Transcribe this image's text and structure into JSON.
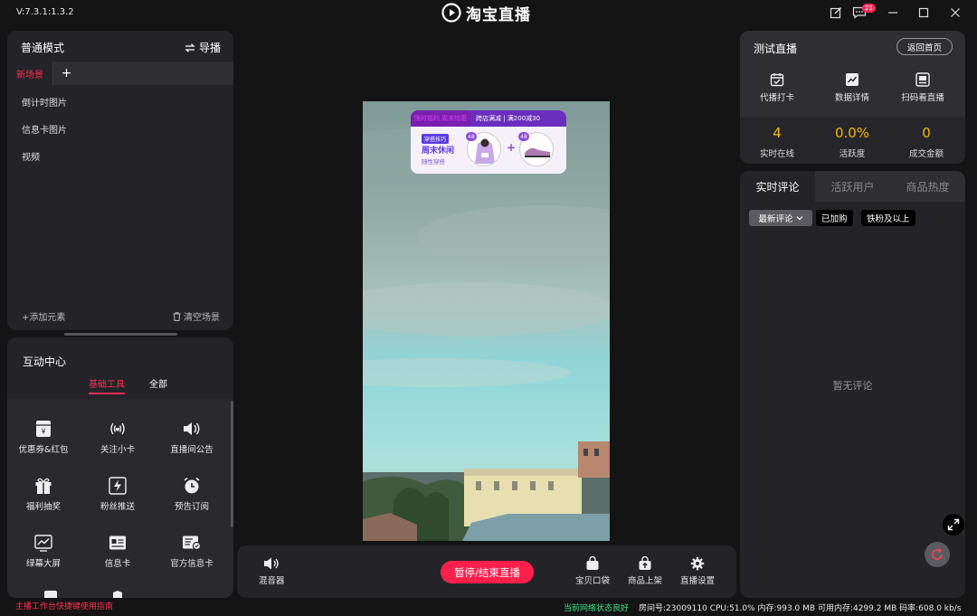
{
  "app": {
    "version": "V:7.3.1:1.3.2",
    "brand": "淘宝直播",
    "message_badge": "21"
  },
  "scene_panel": {
    "mode_title": "普通模式",
    "guide_label": "导播",
    "active_scene_tab": "新场景",
    "add_scene_label": "+",
    "elements": [
      "倒计时图片",
      "信息卡图片",
      "视频"
    ],
    "add_element_label": "+添加元素",
    "clear_scene_label": "清空场景"
  },
  "interaction_center": {
    "title": "互动中心",
    "tabs": [
      "基础工具",
      "全部"
    ],
    "active_tab": "基础工具",
    "tools": [
      {
        "label": "优惠券&红包",
        "icon": "coupon-icon"
      },
      {
        "label": "关注小卡",
        "icon": "follow-signal-icon"
      },
      {
        "label": "直播间公告",
        "icon": "speaker-icon"
      },
      {
        "label": "福利抽奖",
        "icon": "gift-icon"
      },
      {
        "label": "粉丝推送",
        "icon": "lightning-icon"
      },
      {
        "label": "预告订阅",
        "icon": "alarm-clock-icon"
      },
      {
        "label": "绿幕大屏",
        "icon": "chart-screen-icon"
      },
      {
        "label": "信息卡",
        "icon": "info-card-icon"
      },
      {
        "label": "官方信息卡",
        "icon": "official-card-icon"
      }
    ],
    "shortcut_guide": "主播工作台快捷键使用指南"
  },
  "preview": {
    "promo": {
      "tag": "限时福利 周末特惠",
      "cross_store": "跨店满减 | 满200减30",
      "badge": "穿搭技巧",
      "title": "周末休闲",
      "subtitle": "随性穿搭",
      "product_badge_1": "48",
      "product_badge_2": "48",
      "plus": "+"
    }
  },
  "bottom_bar": {
    "mixer_label": "混音器",
    "stop_label": "暂停/结束直播",
    "bag_label": "宝贝口袋",
    "shelf_label": "商品上架",
    "settings_label": "直播设置"
  },
  "live_panel": {
    "title": "测试直播",
    "back_home": "返回首页",
    "tools": [
      {
        "label": "代播打卡",
        "icon": "calendar-check-icon"
      },
      {
        "label": "数据详情",
        "icon": "trend-chart-icon"
      },
      {
        "label": "扫码看直播",
        "icon": "qr-scan-icon"
      }
    ],
    "stats": [
      {
        "value": "4",
        "label": "实时在线"
      },
      {
        "value": "0.0%",
        "label": "活跃度"
      },
      {
        "value": "0",
        "label": "成交金额"
      }
    ]
  },
  "comments": {
    "tabs": [
      "实时评论",
      "活跃用户",
      "商品热度"
    ],
    "active_tab": "实时评论",
    "filter_latest": "最新评论",
    "filter_purchased": "已加购",
    "filter_fans": "铁粉及以上",
    "empty_text": "暂无评论"
  },
  "status": {
    "network": "当前网络状态良好",
    "system": "房间号:23009110 CPU:51.0% 内存:993.0 MB 可用内存:4299.2 MB 码率:608.0 kb/s"
  },
  "colors": {
    "accent": "#ff2d55",
    "stat": "#f5b800",
    "network_ok": "#39e08a"
  }
}
